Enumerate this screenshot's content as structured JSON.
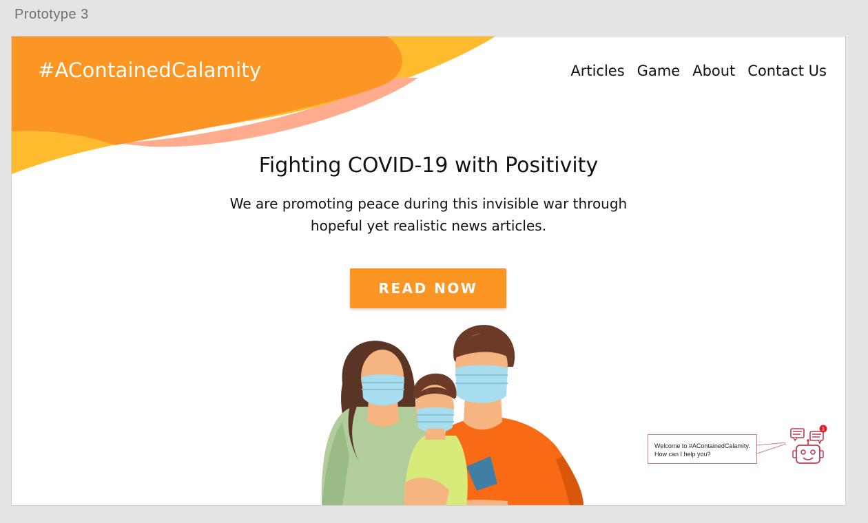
{
  "window": {
    "artboard_label": "Prototype 3"
  },
  "header": {
    "logo": "#AContainedCalamity",
    "nav": [
      {
        "label": "Articles"
      },
      {
        "label": "Game"
      },
      {
        "label": "About"
      },
      {
        "label": "Contact Us"
      }
    ]
  },
  "hero": {
    "title": "Fighting COVID-19 with Positivity",
    "subtitle_line1": "We are promoting peace during this invisible war through",
    "subtitle_line2": "hopeful yet realistic news articles.",
    "cta_label": "READ NOW"
  },
  "chatbot": {
    "message_line1": "Welcome to #AContainedCalamity.",
    "message_line2": "How can I help you?",
    "badge_count": "1",
    "icon": "robot-chat-icon"
  },
  "colors": {
    "primary_orange": "#fb9524",
    "yellow": "#fdbb2d",
    "salmon": "#ffab8e",
    "chat_accent": "#c0394f"
  }
}
